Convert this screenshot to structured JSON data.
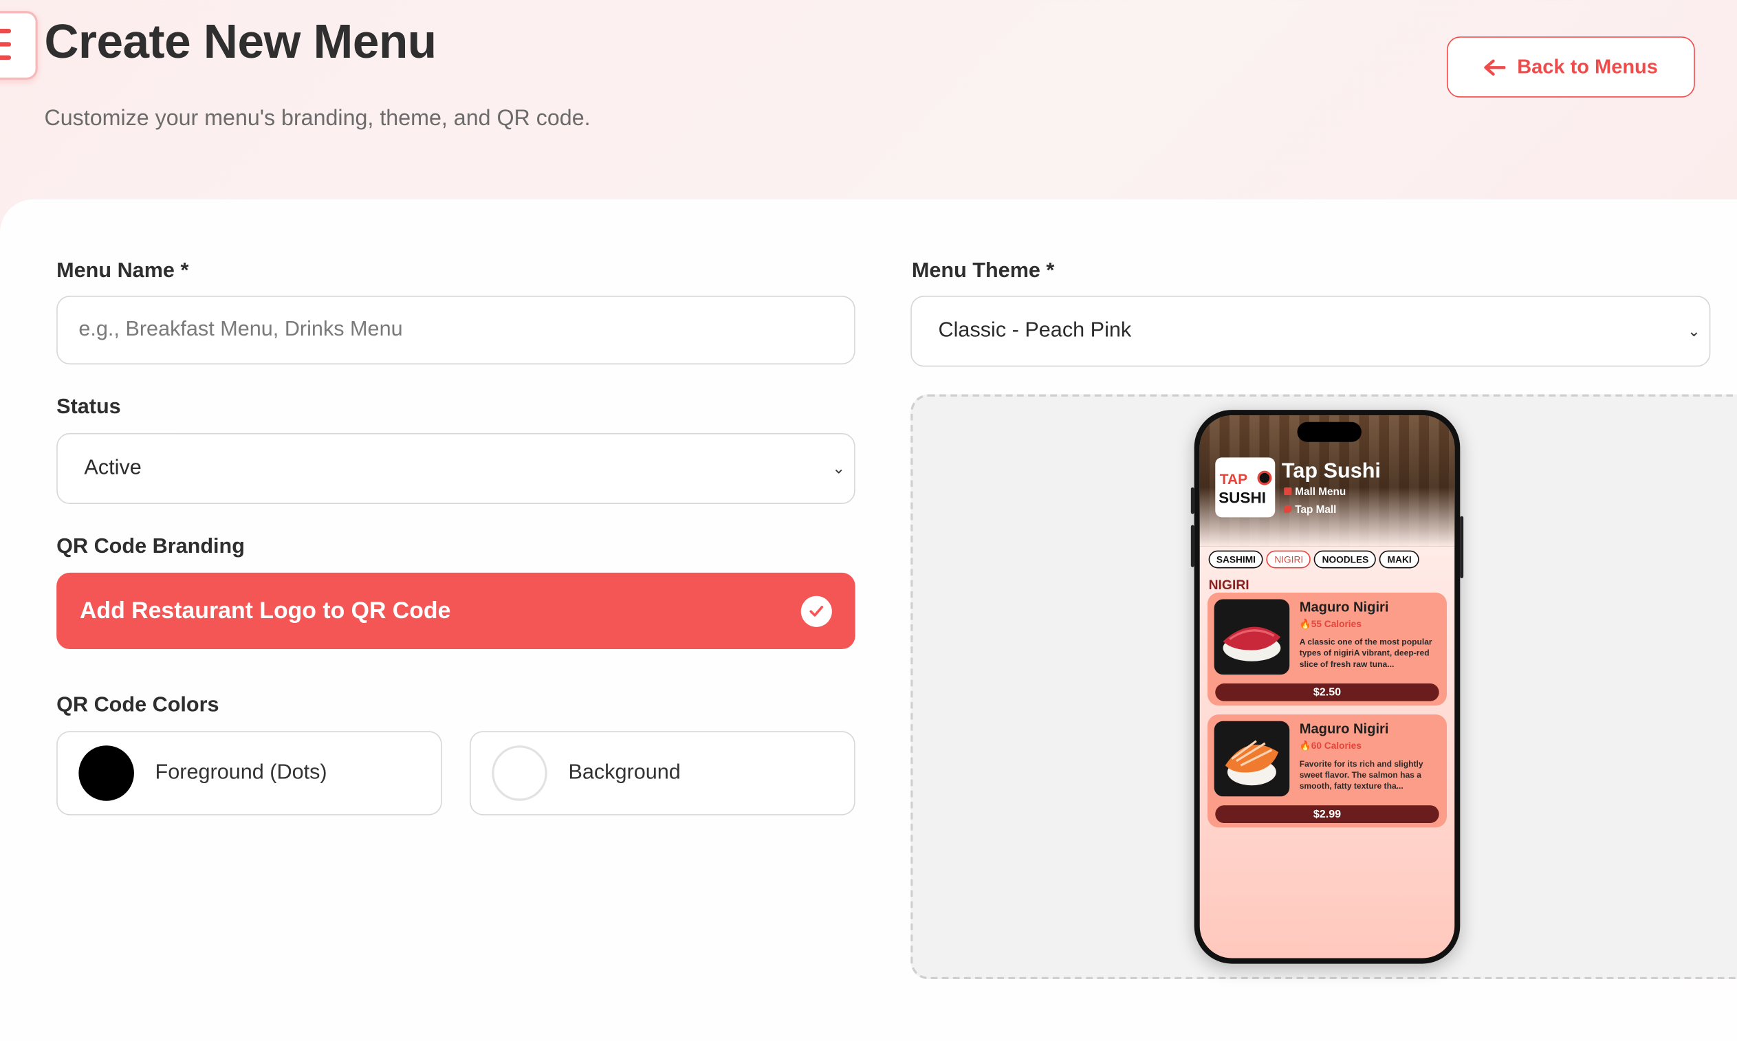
{
  "header": {
    "title": "Create New Menu",
    "subtitle": "Customize your menu's branding, theme, and QR code.",
    "back_label": "Back to Menus"
  },
  "form": {
    "menu_name": {
      "label": "Menu Name *",
      "placeholder": "e.g., Breakfast Menu, Drinks Menu",
      "value": ""
    },
    "status": {
      "label": "Status",
      "value": "Active"
    },
    "qr_branding": {
      "label": "QR Code Branding",
      "toggle_label": "Add Restaurant Logo to QR Code",
      "checked": true
    },
    "qr_colors": {
      "label": "QR Code Colors",
      "foreground": {
        "label": "Foreground (Dots)",
        "color": "#000000"
      },
      "background": {
        "label": "Background",
        "color": "#ffffff"
      }
    },
    "theme": {
      "label": "Menu Theme *",
      "value": "Classic - Peach Pink"
    }
  },
  "preview": {
    "logo_top": "TAP",
    "logo_bottom": "SUSHI",
    "restaurant_name": "Tap Sushi",
    "menu_label": "Mall Menu",
    "location": "Tap Mall",
    "tabs": [
      "SASHIMI",
      "NIGIRI",
      "NOODLES",
      "MAKI"
    ],
    "active_tab": "NIGIRI",
    "section_title": "NIGIRI",
    "items": [
      {
        "name": "Maguro Nigiri",
        "calories": "55 Calories",
        "description": "A classic one of the most popular types of nigiriA vibrant, deep-red slice of fresh raw tuna...",
        "price": "$2.50"
      },
      {
        "name": "Maguro Nigiri",
        "calories": "60 Calories",
        "description": "Favorite for its rich and slightly sweet flavor. The salmon has a smooth, fatty texture tha...",
        "price": "$2.99"
      }
    ]
  },
  "colors": {
    "accent": "#ef4b4b",
    "toggle_bg": "#f45555",
    "card_bg": "#fb9d88",
    "price_bg": "#6b1c1c"
  }
}
